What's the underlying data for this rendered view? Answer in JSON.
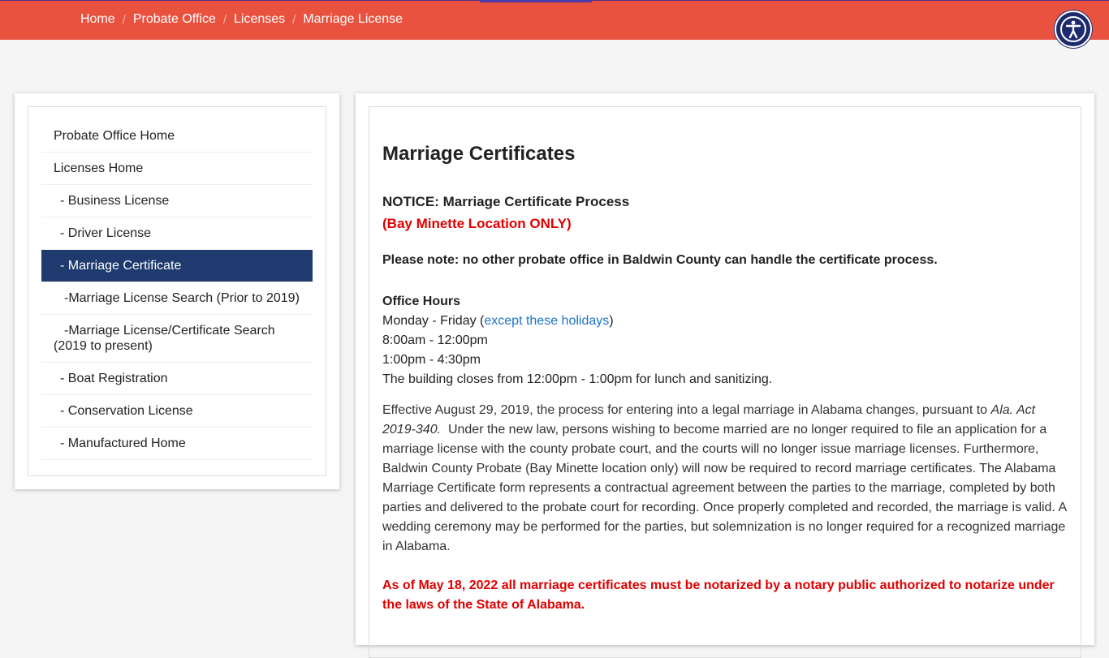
{
  "breadcrumb": [
    "Home",
    "Probate Office",
    "Licenses",
    "Marriage License"
  ],
  "sidebar": {
    "items": [
      {
        "label": "Probate Office Home"
      },
      {
        "label": "Licenses Home"
      },
      {
        "label": "- Business License"
      },
      {
        "label": "- Driver License"
      },
      {
        "label": "- Marriage Certificate",
        "active": true
      },
      {
        "label": "-Marriage License Search (Prior to 2019)"
      },
      {
        "label": "-Marriage License/Certificate Search (2019 to present)"
      },
      {
        "label": "- Boat Registration"
      },
      {
        "label": "- Conservation License"
      },
      {
        "label": "- Manufactured Home"
      }
    ]
  },
  "main": {
    "title": "Marriage Certificates",
    "notice_line1": "NOTICE: Marriage Certificate Process",
    "notice_line2": "(Bay Minette Location ONLY)",
    "note": "Please note: no other probate office in Baldwin County can handle the certificate process.",
    "hours": {
      "heading": "Office Hours",
      "days_prefix": "Monday - Friday (",
      "holidays_link": "except these holidays",
      "days_suffix": ")",
      "morning": "8:00am - 12:00pm",
      "afternoon": "1:00pm - 4:30pm",
      "closure": "The building closes from 12:00pm - 1:00pm for lunch and sanitizing."
    },
    "para_prefix": "Effective August 29, 2019, the process for entering into a legal marriage in Alabama changes, pursuant to ",
    "para_act": "Ala. Act 2019-340.",
    "para_rest": "  Under the new law, persons wishing to become married are no longer required to file an application for a marriage license with the county probate court, and the courts will no longer issue marriage licenses. Furthermore, Baldwin County Probate (Bay Minette location only) will now be required to record marriage certificates. The Alabama Marriage Certificate form represents a contractual agreement between the parties to the marriage, completed by both parties and delivered to the probate court for recording. Once properly completed and recorded, the marriage is valid. A wedding ceremony may be performed for the parties, but solemnization is no longer required for a recognized marriage in Alabama.",
    "warning": "As of May 18, 2022 all marriage certificates must be notarized by a notary public authorized to notarize under the laws of the State of Alabama."
  },
  "colors": {
    "topbar": "#e8523f",
    "active_nav": "#1f3a6e",
    "accent_red": "#e00000",
    "link": "#1a73c8"
  },
  "icons": {
    "accessibility": "accessibility-icon"
  }
}
